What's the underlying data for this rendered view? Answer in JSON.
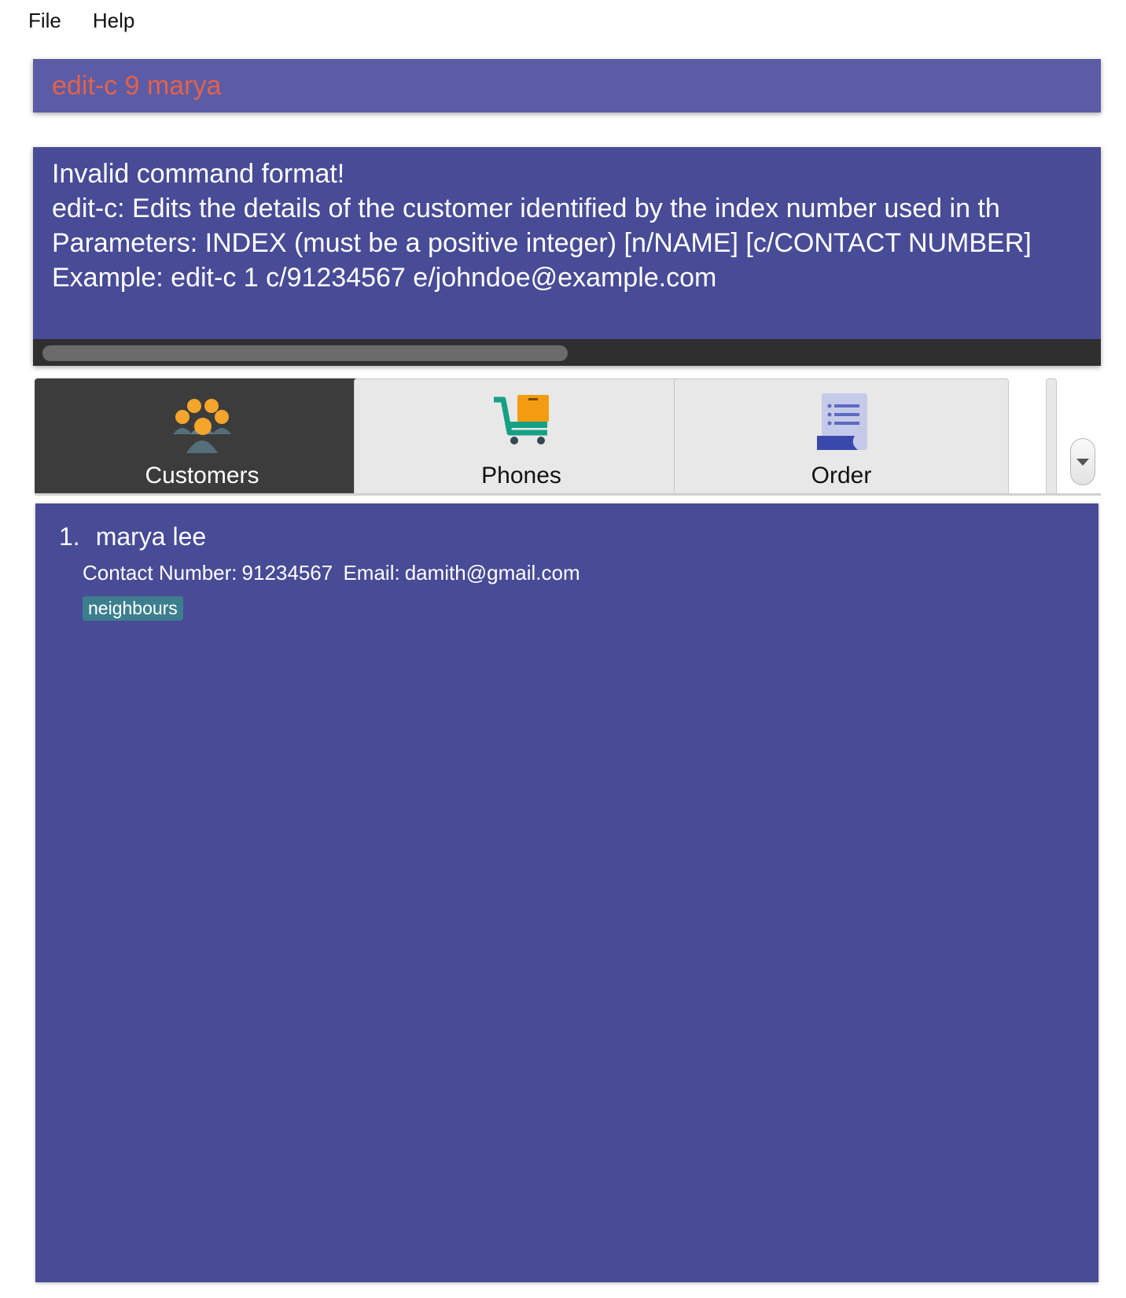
{
  "menu": {
    "file_label": "File",
    "help_label": "Help"
  },
  "command_box": {
    "value": "edit-c 9 marya"
  },
  "result_display": {
    "lines": [
      "Invalid command format!",
      "edit-c: Edits the details of the customer identified by the index number used in th",
      "Parameters: INDEX (must be a positive integer) [n/NAME] [c/CONTACT NUMBER]",
      "Example: edit-c 1 c/91234567 e/johndoe@example.com"
    ]
  },
  "tabs": [
    {
      "label": "Customers",
      "icon": "customers-group-icon",
      "active": true
    },
    {
      "label": "Phones",
      "icon": "shopping-cart-icon",
      "active": false
    },
    {
      "label": "Order",
      "icon": "order-document-icon",
      "active": false
    }
  ],
  "customers": [
    {
      "index": "1.",
      "name": "marya lee",
      "contact_label": "Contact Number:",
      "contact_value": "91234567",
      "email_label": "Email:",
      "email_value": "damith@gmail.com",
      "tags": [
        "neighbours"
      ]
    }
  ],
  "colors": {
    "command_bg": "#5c5ca6",
    "command_text": "#e2624a",
    "panel_bg": "#484b96",
    "tag_bg": "#3c7e8e",
    "active_tab_bg": "#3c3c3c"
  }
}
